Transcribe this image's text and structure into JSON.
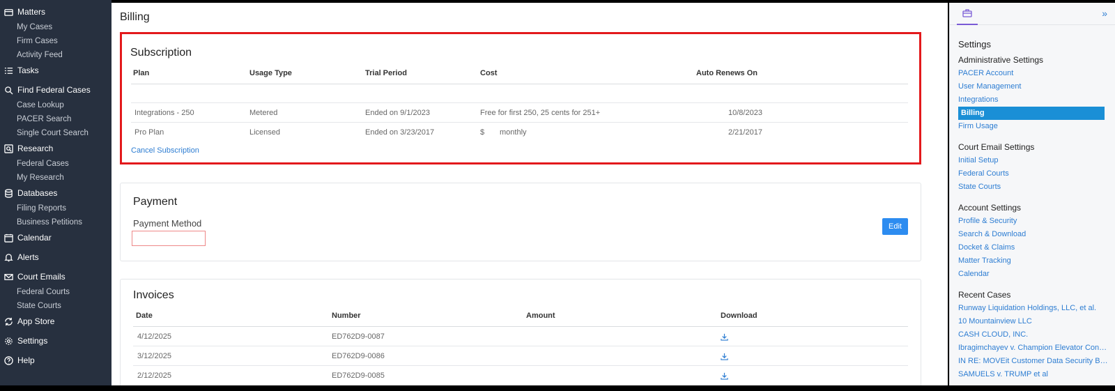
{
  "sidebar": {
    "sections": [
      {
        "label": "Matters",
        "icon": "folder-icon",
        "items": [
          "My Cases",
          "Firm Cases",
          "Activity Feed"
        ]
      },
      {
        "label": "Tasks",
        "icon": "tasks-icon",
        "items": []
      },
      {
        "label": "Find Federal Cases",
        "icon": "search-icon",
        "items": [
          "Case Lookup",
          "PACER Search",
          "Single Court Search"
        ]
      },
      {
        "label": "Research",
        "icon": "research-icon",
        "items": [
          "Federal Cases",
          "My Research"
        ]
      },
      {
        "label": "Databases",
        "icon": "database-icon",
        "items": [
          "Filing Reports",
          "Business Petitions"
        ]
      },
      {
        "label": "Calendar",
        "icon": "calendar-icon",
        "items": []
      },
      {
        "label": "Alerts",
        "icon": "bell-icon",
        "items": []
      },
      {
        "label": "Court Emails",
        "icon": "mail-icon",
        "items": [
          "Federal Courts",
          "State Courts"
        ]
      },
      {
        "label": "App Store",
        "icon": "refresh-icon",
        "items": []
      },
      {
        "label": "Settings",
        "icon": "gear-icon",
        "items": []
      },
      {
        "label": "Help",
        "icon": "help-icon",
        "items": []
      }
    ]
  },
  "main": {
    "title": "Billing",
    "subscription": {
      "title": "Subscription",
      "headers": [
        "Plan",
        "Usage Type",
        "Trial Period",
        "Cost",
        "Auto Renews On"
      ],
      "rows": [
        {
          "plan": "Integrations - 250",
          "usage": "Metered",
          "trial": "Ended on 9/1/2023",
          "cost": "Free for first 250, 25 cents for 251+",
          "cost_extra": "",
          "renews": "10/8/2023"
        },
        {
          "plan": "Pro Plan",
          "usage": "Licensed",
          "trial": "Ended on 3/23/2017",
          "cost": "$",
          "cost_extra": "monthly",
          "renews": "2/21/2017"
        }
      ],
      "cancel_label": "Cancel Subscription"
    },
    "payment": {
      "title": "Payment",
      "method_label": "Payment Method",
      "edit_label": "Edit"
    },
    "invoices": {
      "title": "Invoices",
      "headers": [
        "Date",
        "Number",
        "Amount",
        "Download"
      ],
      "rows": [
        {
          "date": "4/12/2025",
          "number": "ED762D9-0087",
          "amount": ""
        },
        {
          "date": "3/12/2025",
          "number": "ED762D9-0086",
          "amount": ""
        },
        {
          "date": "2/12/2025",
          "number": "ED762D9-0085",
          "amount": ""
        }
      ]
    }
  },
  "right_panel": {
    "title": "Settings",
    "groups": [
      {
        "heading": "Administrative Settings",
        "links": [
          "PACER Account",
          "User Management",
          "Integrations",
          "Billing",
          "Firm Usage"
        ],
        "active": "Billing"
      },
      {
        "heading": "Court Email Settings",
        "links": [
          "Initial Setup",
          "Federal Courts",
          "State Courts"
        ]
      },
      {
        "heading": "Account Settings",
        "links": [
          "Profile & Security",
          "Search & Download",
          "Docket & Claims",
          "Matter Tracking",
          "Calendar"
        ]
      },
      {
        "heading": "Recent Cases",
        "links": [
          "Runway Liquidation Holdings, LLC, et al.",
          "10 Mountainview LLC",
          "CASH CLOUD, INC.",
          "Ibragimchayev v. Champion Elevator Const...",
          "IN RE: MOVEit Customer Data Security Bre...",
          "SAMUELS v. TRUMP et al"
        ]
      }
    ]
  },
  "colors": {
    "sidebar_bg": "#27303f",
    "accent": "#2d7dd2",
    "active_link_bg": "#1a8fd6",
    "highlight_border": "#e3191c",
    "button_bg": "#2d8cf0"
  }
}
